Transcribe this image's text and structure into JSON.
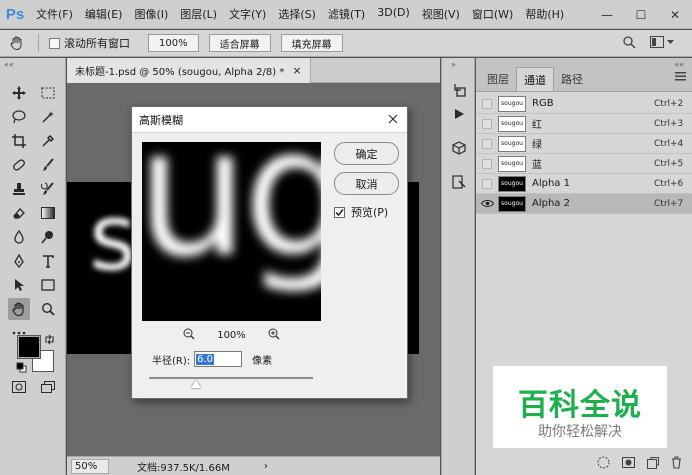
{
  "app": {
    "logo": "Ps",
    "menu": [
      "文件(F)",
      "编辑(E)",
      "图像(I)",
      "图层(L)",
      "文字(Y)",
      "选择(S)",
      "滤镜(T)",
      "3D(D)",
      "视图(V)",
      "窗口(W)",
      "帮助(H)"
    ],
    "window_controls": [
      "—",
      "☐",
      "✕"
    ]
  },
  "options_bar": {
    "scroll_all_windows_label": "滚动所有窗口",
    "zoom_value": "100%",
    "fit_screen_label": "适合屏幕",
    "fill_screen_label": "填充屏幕"
  },
  "document": {
    "tab_title": "未标题-1.psd @ 50% (sougou, Alpha 2/8) *",
    "tab_close": "×",
    "canvas_text": "s",
    "status_zoom": "50%",
    "status_doc": "文档:937.5K/1.66M"
  },
  "panel": {
    "tabs": [
      "图层",
      "通道",
      "路径"
    ],
    "active_tab": 1,
    "channels": [
      {
        "name": "RGB",
        "shortcut": "Ctrl+2",
        "thumb": "sougou",
        "dark": false,
        "visible": false,
        "selected": false
      },
      {
        "name": "红",
        "shortcut": "Ctrl+3",
        "thumb": "sougou",
        "dark": false,
        "visible": false,
        "selected": false
      },
      {
        "name": "绿",
        "shortcut": "Ctrl+4",
        "thumb": "sougou",
        "dark": false,
        "visible": false,
        "selected": false
      },
      {
        "name": "蓝",
        "shortcut": "Ctrl+5",
        "thumb": "sougou",
        "dark": false,
        "visible": false,
        "selected": false
      },
      {
        "name": "Alpha 1",
        "shortcut": "Ctrl+6",
        "thumb": "sougou",
        "dark": true,
        "visible": false,
        "selected": false
      },
      {
        "name": "Alpha 2",
        "shortcut": "Ctrl+7",
        "thumb": "sougou",
        "dark": true,
        "visible": true,
        "selected": true
      }
    ]
  },
  "dialog": {
    "title": "高斯模糊",
    "ok_label": "确定",
    "cancel_label": "取消",
    "preview_label": "预览(P)",
    "preview_checked": true,
    "preview_text": "ug",
    "zoom_level": "100%",
    "radius_label": "半径(R):",
    "radius_value": "6.0",
    "radius_unit": "像素"
  },
  "watermark": {
    "title": "百科全说",
    "subtitle": "助你轻松解决"
  }
}
